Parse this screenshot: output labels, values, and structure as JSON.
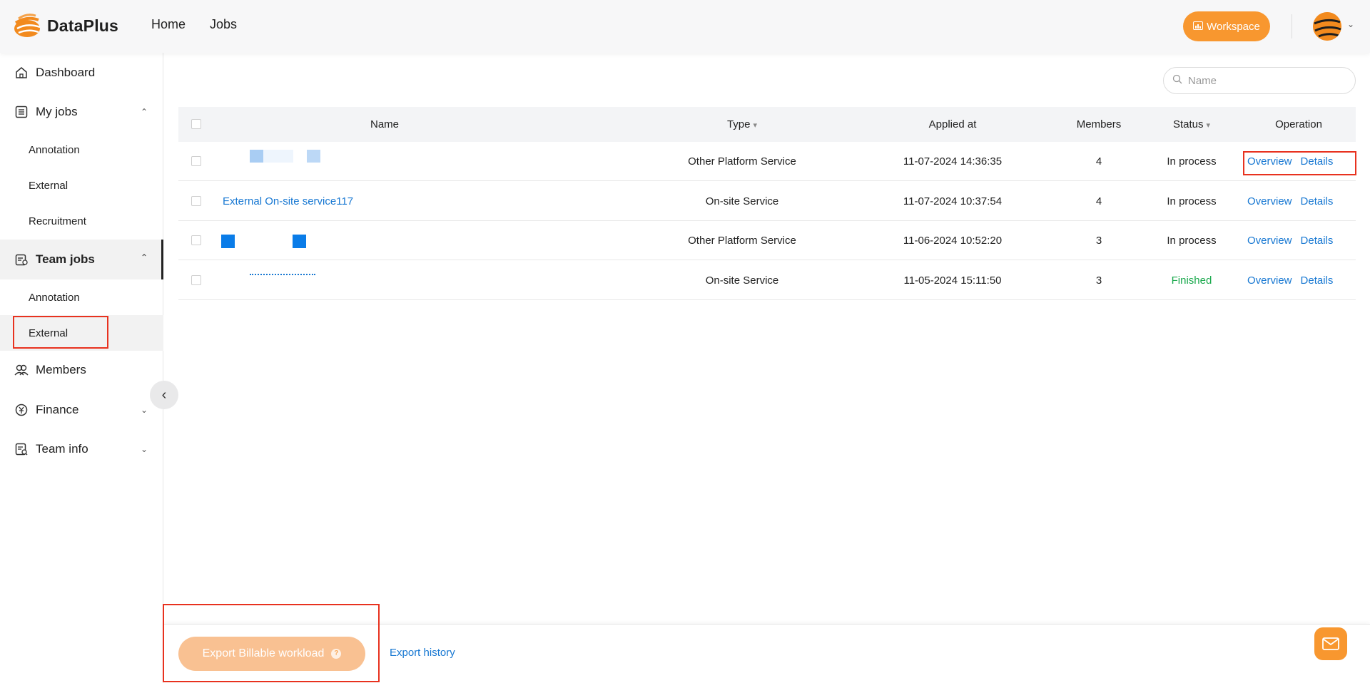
{
  "app": {
    "name": "DataPlus"
  },
  "topnav": {
    "home": "Home",
    "jobs": "Jobs"
  },
  "header": {
    "workspace_label": "Workspace"
  },
  "sidebar": {
    "dashboard": "Dashboard",
    "my_jobs": "My jobs",
    "my_jobs_items": [
      "Annotation",
      "External",
      "Recruitment"
    ],
    "team_jobs": "Team jobs",
    "team_jobs_items": [
      "Annotation",
      "External"
    ],
    "members": "Members",
    "finance": "Finance",
    "team_info": "Team info"
  },
  "search": {
    "placeholder": "Name"
  },
  "table": {
    "columns": [
      "Name",
      "Type",
      "Applied at",
      "Members",
      "Status",
      "Operation"
    ],
    "rows": [
      {
        "name": "",
        "type": "Other Platform Service",
        "applied_at": "11-07-2024 14:36:35",
        "members": "4",
        "status": "In process",
        "op1": "Overview",
        "op2": "Details"
      },
      {
        "name": "External On-site service117",
        "type": "On-site Service",
        "applied_at": "11-07-2024 10:37:54",
        "members": "4",
        "status": "In process",
        "op1": "Overview",
        "op2": "Details"
      },
      {
        "name": "",
        "type": "Other Platform Service",
        "applied_at": "11-06-2024 10:52:20",
        "members": "3",
        "status": "In process",
        "op1": "Overview",
        "op2": "Details"
      },
      {
        "name": "",
        "type": "On-site Service",
        "applied_at": "11-05-2024 15:11:50",
        "members": "3",
        "status": "Finished",
        "op1": "Overview",
        "op2": "Details"
      }
    ]
  },
  "footer": {
    "export_button": "Export Billable workload",
    "export_history": "Export history"
  },
  "colors": {
    "accent": "#f8972f",
    "link": "#1677d2",
    "finished": "#18a84b",
    "highlight": "#e8321f"
  },
  "icons": [
    "logo-icon",
    "workspace-icon",
    "avatar-icon",
    "home-icon",
    "jobs-icon",
    "team-jobs-icon",
    "members-icon",
    "finance-icon",
    "team-info-icon",
    "search-icon",
    "filter-icon",
    "collapse-icon",
    "help-icon",
    "mail-icon"
  ]
}
